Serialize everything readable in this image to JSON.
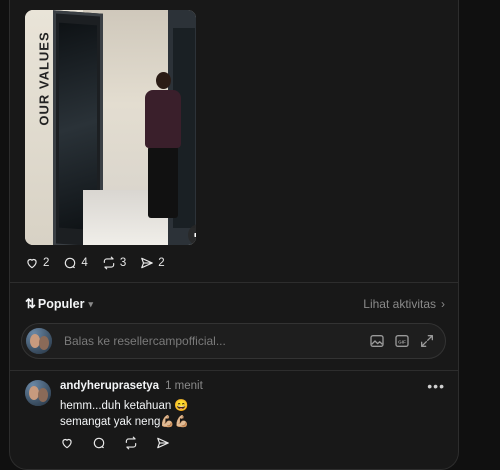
{
  "post": {
    "video_text": "OUR VALUES",
    "mute_icon": "speaker-muted-icon",
    "stats": {
      "likes": "2",
      "comments": "4",
      "reposts": "3",
      "shares": "2"
    }
  },
  "sort": {
    "label": "Populer",
    "activity_link": "Lihat aktivitas"
  },
  "reply": {
    "placeholder": "Balas ke resellercampofficial..."
  },
  "comment": {
    "username": "andyheruprasetya",
    "time": "1 menit",
    "line1": "hemm...duh ketahuan 😄",
    "line2": "semangat yak neng💪🏼💪🏼"
  }
}
